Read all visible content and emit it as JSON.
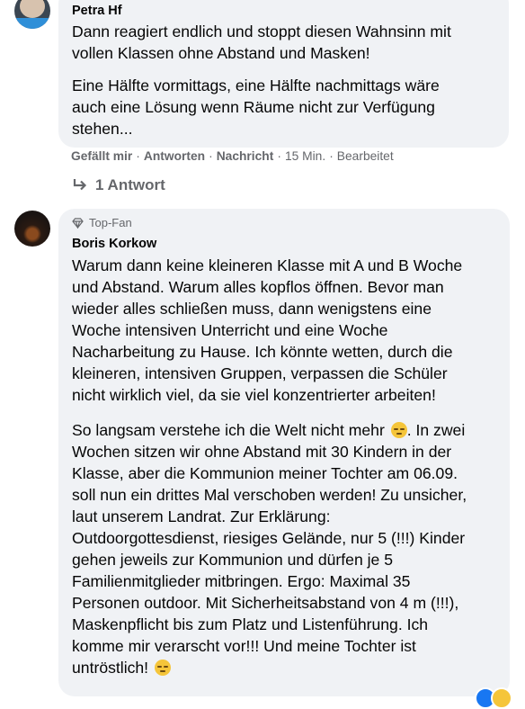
{
  "comment1": {
    "author": "Petra Hf",
    "paragraph1": [
      "Dann reagiert endlich und stoppt diesen Wahnsinn mit",
      "vollen Klassen ohne Abstand und Masken!"
    ],
    "paragraph2": [
      "Eine Hälfte vormittags, eine Hälfte nachmittags wäre",
      "auch eine Lösung wenn Räume nicht zur Verfügung",
      "stehen..."
    ],
    "actions": {
      "like": "Gefällt mir",
      "reply": "Antworten",
      "message": "Nachricht",
      "time": "15 Min.",
      "edited": "Bearbeitet",
      "separator": "·"
    },
    "replies_label": "1 Antwort"
  },
  "comment2": {
    "badge": "Top-Fan",
    "author": "Boris Korkow",
    "paragraph1": [
      "Warum dann keine kleineren Klasse mit A und B Woche",
      "und Abstand. Warum alles kopflos öffnen. Bevor man",
      "wieder alles schließen muss, dann wenigstens eine",
      "Woche intensiven Unterricht und eine Woche",
      "Nacharbeitung zu Hause. Ich könnte wetten, durch die",
      "kleineren, intensiven Gruppen, verpassen die Schüler",
      "nicht wirklich viel, da sie viel konzentrierter arbeiten!"
    ],
    "paragraph2": [
      "So langsam verstehe ich die Welt nicht mehr",
      ". In zwei",
      "Wochen sitzen wir ohne Abstand mit 30 Kindern in der",
      "Klasse, aber die Kommunion meiner Tochter am 06.09.",
      "soll nun ein drittes Mal verschoben werden! Zu unsicher,",
      "laut unserem Landrat. Zur Erklärung:",
      "Outdoorgottesdienst, riesiges Gelände, nur 5 (!!!) Kinder",
      "gehen jeweils zur Kommunion und dürfen je 5",
      "Familienmitglieder mitbringen. Ergo: Maximal 35",
      "Personen outdoor. Mit Sicherheitsabstand von 4 m (!!!),",
      "Maskenpflicht bis zum Platz und Listenführung. Ich",
      "komme mir verarscht vor!!! Und meine Tochter ist",
      "untröstlich!"
    ]
  },
  "colors": {
    "bubble": "#f0f2f5",
    "meta": "#65676b",
    "text": "#050505"
  }
}
